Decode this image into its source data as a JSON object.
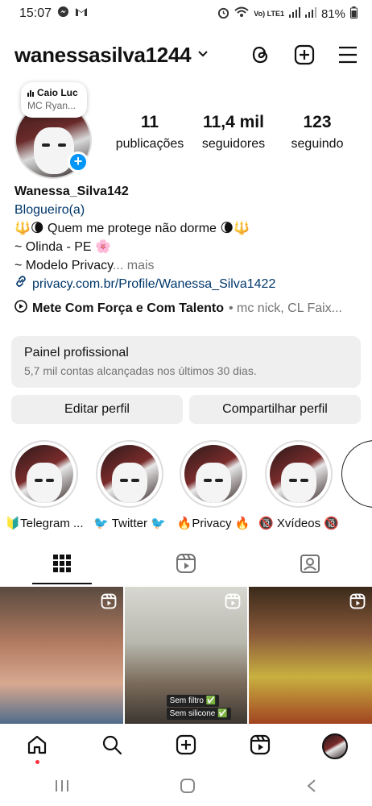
{
  "status_bar": {
    "time": "15:07",
    "battery": "81%",
    "network": "Vo) LTE1"
  },
  "header": {
    "username": "wanessasilva1244"
  },
  "music_bubble": {
    "title": "Caio Luc",
    "artist": "MC Ryan..."
  },
  "stats": [
    {
      "value": "11",
      "label": "publicações"
    },
    {
      "value": "11,4 mil",
      "label": "seguidores"
    },
    {
      "value": "123",
      "label": "seguindo"
    }
  ],
  "bio": {
    "name": "Wanessa_Silva142",
    "category": "Blogueiro(a)",
    "line1": "🔱🌘 Quem me protege não dorme 🌘🔱",
    "line2": "~ Olinda - PE 🌸",
    "line3": "~ Modelo Privacy",
    "more": "... mais",
    "link": "privacy.com.br/Profile/Wanessa_Silva1422"
  },
  "music_row": {
    "song": "Mete Com Força e Com Talento",
    "artist": " • mc nick, CL Faix..."
  },
  "panel": {
    "title": "Painel profissional",
    "subtitle": "5,7 mil contas alcançadas nos últimos 30 dias."
  },
  "buttons": {
    "edit": "Editar perfil",
    "share": "Compartilhar perfil"
  },
  "highlights": [
    {
      "label": "🔰Telegram ..."
    },
    {
      "label": "🐦 Twitter 🐦"
    },
    {
      "label": "🔥Privacy 🔥"
    },
    {
      "label": "🔞 Xvídeos 🔞"
    }
  ],
  "grid_stickers": {
    "s1": "Sem filtro ✅",
    "s2": "Sem silicone ✅"
  }
}
